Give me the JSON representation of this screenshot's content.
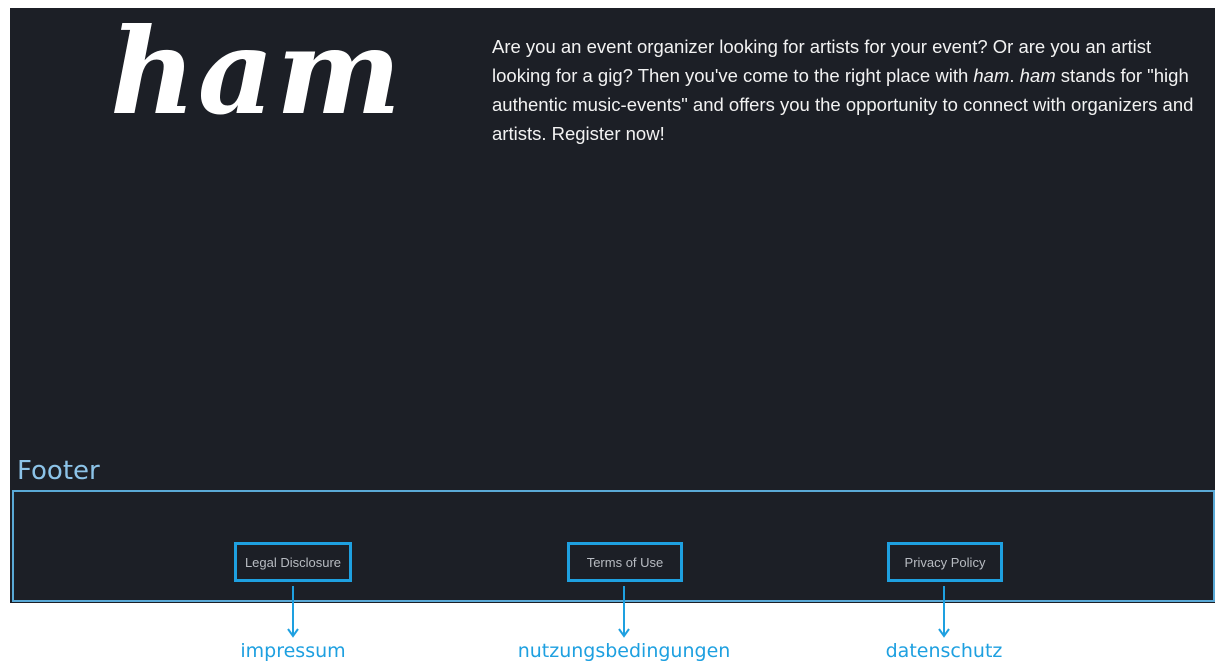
{
  "brand": {
    "logo_text": "ham"
  },
  "intro": {
    "p1": "Are you an event organizer looking for artists for your event? Or are you an artist looking for a gig? Then you've come to the right place with ",
    "brand1": "ham",
    "p2": ". ",
    "brand2": "ham",
    "p3": " stands for \"high authentic music-events\" and offers you the opportunity to connect with organizers and artists. Register now!"
  },
  "footer": {
    "title": "Footer",
    "links": [
      {
        "label": "Legal Disclosure",
        "annotation": "impressum"
      },
      {
        "label": "Terms of Use",
        "annotation": "nutzungsbedingungen"
      },
      {
        "label": "Privacy Policy",
        "annotation": "datenschutz"
      }
    ]
  },
  "colors": {
    "background": "#1c1f26",
    "annotation_blue": "#1ea0e0",
    "footer_title": "#8cc3e8"
  }
}
